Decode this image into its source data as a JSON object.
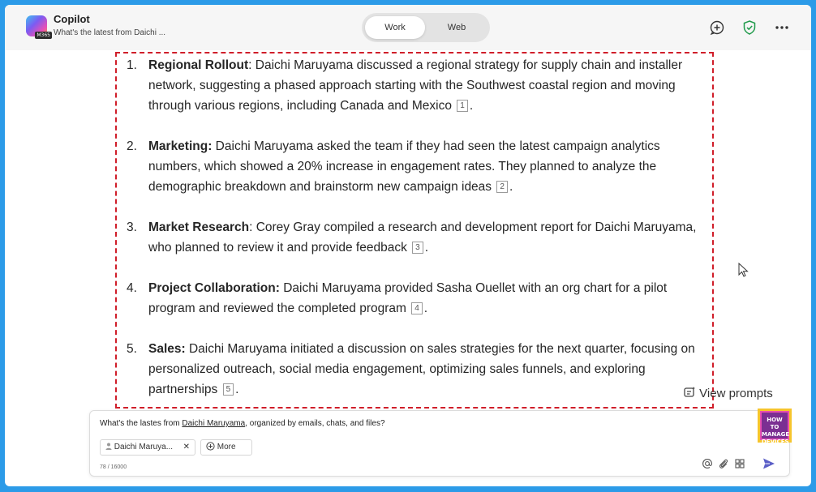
{
  "header": {
    "app_title": "Copilot",
    "conversation_title": "What's the latest from Daichi ...",
    "logo_badge": "M365",
    "toggle": {
      "work": "Work",
      "web": "Web",
      "selected": "Work"
    },
    "icons": [
      "new-chat-icon",
      "shield-check-icon",
      "more-icon"
    ]
  },
  "response": {
    "items": [
      {
        "num": "1.",
        "term": "Regional Rollout",
        "text": ": Daichi Maruyama discussed a regional strategy for supply chain and installer network, suggesting a phased approach starting with the Southwest coastal region and moving through various regions, including Canada and Mexico",
        "cite": "1",
        "end": "."
      },
      {
        "num": "2.",
        "term": "Marketing:",
        "text": " Daichi Maruyama asked the team if they had seen the latest campaign analytics numbers, which showed a 20% increase in engagement rates. They planned to analyze the demographic breakdown and brainstorm new campaign ideas",
        "cite": "2",
        "end": "."
      },
      {
        "num": "3.",
        "term": "Market Research",
        "text": ": Corey Gray compiled a research and development report for Daichi Maruyama, who planned to review it and provide feedback",
        "cite": "3",
        "end": "."
      },
      {
        "num": "4.",
        "term": "Project Collaboration:",
        "text": " Daichi Maruyama provided Sasha Ouellet with an org chart for a pilot program and reviewed the completed program",
        "cite": "4",
        "end": "."
      },
      {
        "num": "5.",
        "term": "Sales:",
        "text": " Daichi Maruyama initiated a discussion on sales strategies for the next quarter, focusing on personalized outreach, social media engagement, optimizing sales funnels, and exploring partnerships",
        "cite": "5",
        "end": "."
      }
    ]
  },
  "view_prompts": "View prompts",
  "composer": {
    "prompt_before": "What's the lastes from ",
    "prompt_mention": "Daichi Maruyama",
    "prompt_after": ", organized by emails, chats, and files?",
    "person_chip": "Daichi Maruya...",
    "more_chip": "More",
    "char_count": "78 / 16000"
  },
  "brand": {
    "line1": "HOW TO",
    "line2": "MANAGE",
    "line3": "DEVICES"
  },
  "colors": {
    "background": "#2c9be8",
    "highlight_border": "#d01e2a",
    "send_accent": "#5b5fc7"
  }
}
